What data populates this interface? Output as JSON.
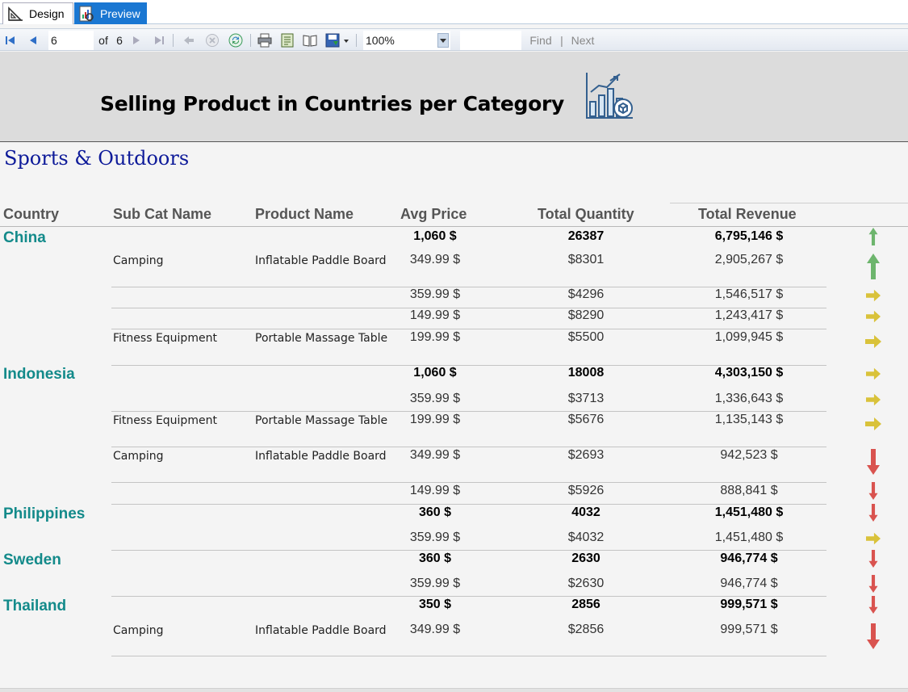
{
  "tabs": {
    "design": "Design",
    "preview": "Preview"
  },
  "toolbar": {
    "page_value": "6",
    "of_label": "of",
    "total_pages": "6",
    "zoom": "100%",
    "find_value": "",
    "find_label": "Find",
    "divider": "|",
    "next_label": "Next"
  },
  "report": {
    "title": "Selling Product in Countries per Category",
    "category": "Sports & Outdoors",
    "headers": {
      "country": "Country",
      "subcat": "Sub Cat Name",
      "product": "Product Name",
      "avg_price": "Avg Price",
      "qty": "Total Quantity",
      "revenue": "Total Revenue"
    },
    "rows": [
      {
        "country": "China",
        "subcat": "",
        "product": "",
        "price": "1,060 $",
        "qty": "26387",
        "revenue": "6,795,146 $",
        "bold": true,
        "trend": "up"
      },
      {
        "country": "",
        "subcat": "Camping",
        "product": "Inflatable Paddle Board",
        "price": "349.99 $",
        "qty": "$8301",
        "revenue": "2,905,267 $",
        "bold": false,
        "trend": "up"
      },
      {
        "country": "",
        "subcat": "",
        "product": "",
        "price": "359.99 $",
        "qty": "$4296",
        "revenue": "1,546,517 $",
        "bold": false,
        "trend": "right"
      },
      {
        "country": "",
        "subcat": "",
        "product": "",
        "price": "149.99 $",
        "qty": "$8290",
        "revenue": "1,243,417 $",
        "bold": false,
        "trend": "right"
      },
      {
        "country": "",
        "subcat": "Fitness Equipment",
        "product": "Portable Massage Table",
        "price": "199.99 $",
        "qty": "$5500",
        "revenue": "1,099,945 $",
        "bold": false,
        "trend": "right"
      },
      {
        "country": "Indonesia",
        "subcat": "",
        "product": "",
        "price": "1,060 $",
        "qty": "18008",
        "revenue": "4,303,150 $",
        "bold": true,
        "trend": "right"
      },
      {
        "country": "",
        "subcat": "",
        "product": "",
        "price": "359.99 $",
        "qty": "$3713",
        "revenue": "1,336,643 $",
        "bold": false,
        "trend": "right"
      },
      {
        "country": "",
        "subcat": "Fitness Equipment",
        "product": "Portable Massage Table",
        "price": "199.99 $",
        "qty": "$5676",
        "revenue": "1,135,143 $",
        "bold": false,
        "trend": "right"
      },
      {
        "country": "",
        "subcat": "Camping",
        "product": "Inflatable Paddle Board",
        "price": "349.99 $",
        "qty": "$2693",
        "revenue": "942,523 $",
        "bold": false,
        "trend": "down"
      },
      {
        "country": "",
        "subcat": "",
        "product": "",
        "price": "149.99 $",
        "qty": "$5926",
        "revenue": "888,841 $",
        "bold": false,
        "trend": "down"
      },
      {
        "country": "Philippines",
        "subcat": "",
        "product": "",
        "price": "360 $",
        "qty": "4032",
        "revenue": "1,451,480 $",
        "bold": true,
        "trend": "down"
      },
      {
        "country": "",
        "subcat": "",
        "product": "",
        "price": "359.99 $",
        "qty": "$4032",
        "revenue": "1,451,480 $",
        "bold": false,
        "trend": "right"
      },
      {
        "country": "Sweden",
        "subcat": "",
        "product": "",
        "price": "360 $",
        "qty": "2630",
        "revenue": "946,774 $",
        "bold": true,
        "trend": "down"
      },
      {
        "country": "",
        "subcat": "",
        "product": "",
        "price": "359.99 $",
        "qty": "$2630",
        "revenue": "946,774 $",
        "bold": false,
        "trend": "down"
      },
      {
        "country": "Thailand",
        "subcat": "",
        "product": "",
        "price": "350 $",
        "qty": "2856",
        "revenue": "999,571 $",
        "bold": true,
        "trend": "down"
      },
      {
        "country": "",
        "subcat": "Camping",
        "product": "Inflatable Paddle Board",
        "price": "349.99 $",
        "qty": "$2856",
        "revenue": "999,571 $",
        "bold": false,
        "trend": "down"
      }
    ]
  },
  "colors": {
    "country": "#138a8a",
    "category": "#0d1a99",
    "up": "#6db56d",
    "right": "#d9c23a",
    "down": "#d9534f"
  },
  "icons": [
    "first-page-icon",
    "prev-page-icon",
    "next-page-icon",
    "last-page-icon",
    "back-icon",
    "stop-icon",
    "refresh-icon",
    "print-icon",
    "page-setup-icon",
    "print-layout-icon",
    "export-icon",
    "report-chart-icon"
  ]
}
